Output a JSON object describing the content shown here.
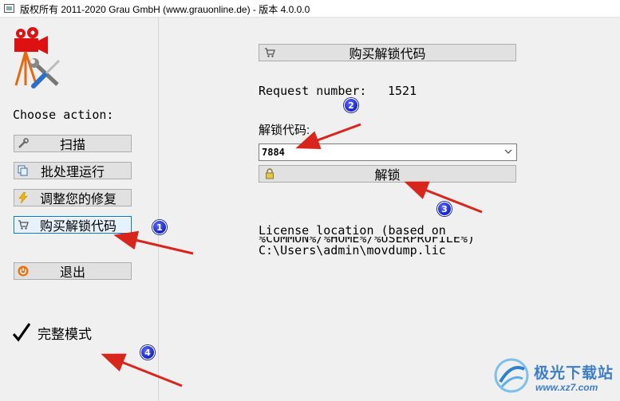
{
  "window": {
    "title": "版权所有 2011-2020 Grau GmbH (www.grauonline.de) - 版本 4.0.0.0"
  },
  "left": {
    "choose_action": "Choose action:",
    "buttons": [
      {
        "label": "扫描",
        "icon": "wrench-icon"
      },
      {
        "label": "批处理运行",
        "icon": "copy-icon"
      },
      {
        "label": "调整您的修复",
        "icon": "lightning-icon"
      },
      {
        "label": "购买解锁代码",
        "icon": "cart-icon"
      },
      {
        "label": "退出",
        "icon": "power-icon"
      }
    ],
    "full_mode": "完整模式"
  },
  "right": {
    "buy_button": "购买解锁代码",
    "request_label": "Request number:",
    "request_number": "1521",
    "unlock_label": "解锁代码:",
    "unlock_code": "7884",
    "unlock_button": "解锁",
    "license_line1": "License location (based on",
    "license_line2": "%COMMON%/%HOME%/%USERPROFILE%)",
    "license_line3": "C:\\Users\\admin\\movdump.lic"
  },
  "annotations": {
    "badges": [
      "1",
      "2",
      "3",
      "4"
    ],
    "arrow_color": "#d9261c",
    "badge_color": "#1622c8"
  },
  "watermark": {
    "name": "极光下载站",
    "url": "www.xz7.com"
  }
}
